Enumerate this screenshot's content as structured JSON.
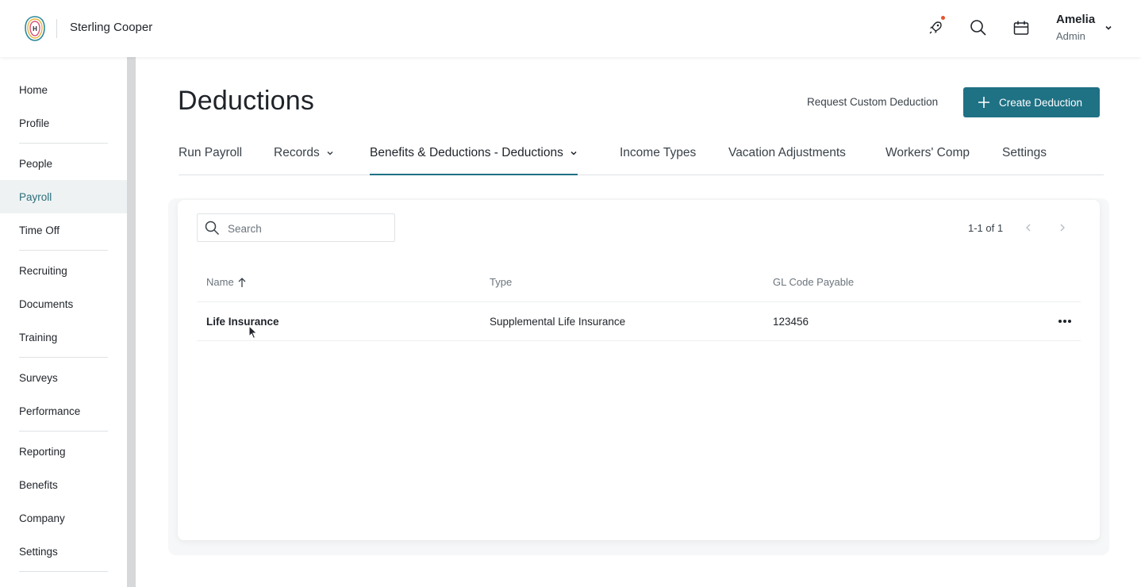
{
  "header": {
    "company": "Sterling Cooper",
    "user_name": "Amelia",
    "user_role": "Admin",
    "notification_color": "#e5532d"
  },
  "sidebar": {
    "active": "Payroll",
    "items": [
      {
        "label": "Home"
      },
      {
        "label": "Profile"
      },
      {
        "label": "People"
      },
      {
        "label": "Payroll"
      },
      {
        "label": "Time Off"
      },
      {
        "label": "Recruiting"
      },
      {
        "label": "Documents"
      },
      {
        "label": "Training"
      },
      {
        "label": "Surveys"
      },
      {
        "label": "Performance"
      },
      {
        "label": "Reporting"
      },
      {
        "label": "Benefits"
      },
      {
        "label": "Company"
      },
      {
        "label": "Settings"
      }
    ]
  },
  "page": {
    "title": "Deductions",
    "request_link": "Request Custom Deduction",
    "create_button": "Create Deduction",
    "accent_color": "#1f7184"
  },
  "tabs": [
    {
      "label": "Run Payroll"
    },
    {
      "label": "Records"
    },
    {
      "label": "Benefits & Deductions - Deductions"
    },
    {
      "label": "Income Types"
    },
    {
      "label": "Vacation Adjustments"
    },
    {
      "label": "Workers' Comp"
    },
    {
      "label": "Settings"
    }
  ],
  "table": {
    "search_placeholder": "Search",
    "pagination": "1-1 of 1",
    "columns": [
      "Name",
      "Type",
      "GL Code Payable"
    ],
    "sort_column": "Name",
    "sort_direction": "ascending",
    "rows": [
      {
        "name": "Life Insurance",
        "type": "Supplemental Life Insurance",
        "gl_code": "123456"
      }
    ]
  }
}
